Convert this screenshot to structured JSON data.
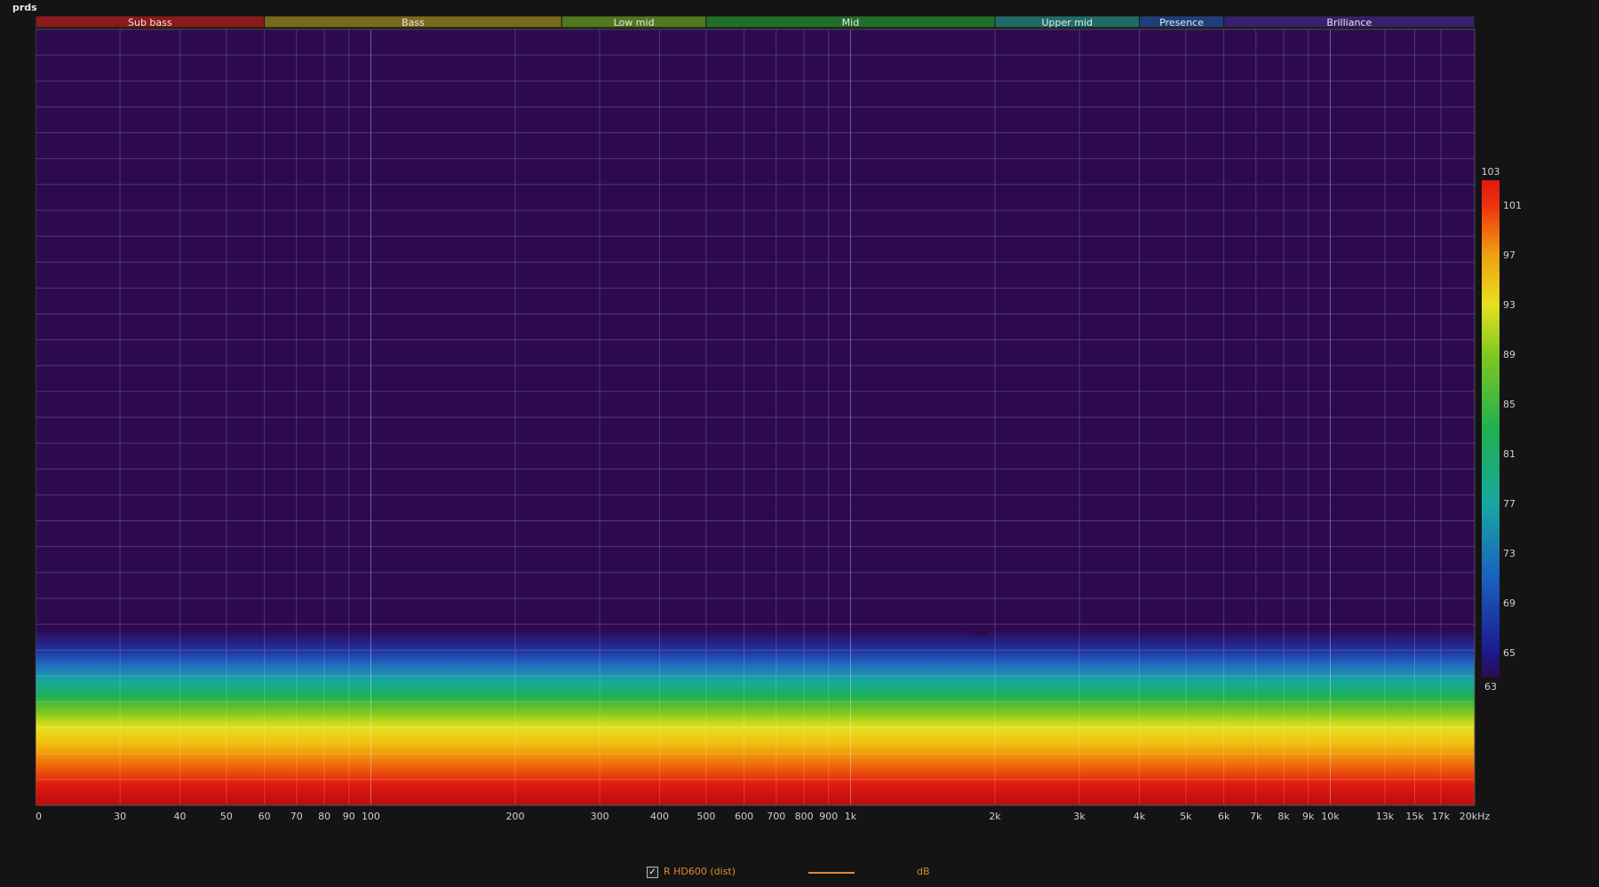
{
  "chart_data": {
    "type": "heatmap",
    "title": "",
    "ylabel_unit": "prds",
    "xlabel_unit": "Hz",
    "x_scale": "log",
    "xlim": [
      20,
      20000
    ],
    "ylim": [
      0,
      30
    ],
    "x_ticks": [
      {
        "value": 20,
        "label": "20"
      },
      {
        "value": 30,
        "label": "30"
      },
      {
        "value": 40,
        "label": "40"
      },
      {
        "value": 50,
        "label": "50"
      },
      {
        "value": 60,
        "label": "60"
      },
      {
        "value": 70,
        "label": "70"
      },
      {
        "value": 80,
        "label": "80"
      },
      {
        "value": 90,
        "label": "90"
      },
      {
        "value": 100,
        "label": "100"
      },
      {
        "value": 200,
        "label": "200"
      },
      {
        "value": 300,
        "label": "300"
      },
      {
        "value": 400,
        "label": "400"
      },
      {
        "value": 500,
        "label": "500"
      },
      {
        "value": 600,
        "label": "600"
      },
      {
        "value": 700,
        "label": "700"
      },
      {
        "value": 800,
        "label": "800"
      },
      {
        "value": 900,
        "label": "900"
      },
      {
        "value": 1000,
        "label": "1k"
      },
      {
        "value": 2000,
        "label": "2k"
      },
      {
        "value": 3000,
        "label": "3k"
      },
      {
        "value": 4000,
        "label": "4k"
      },
      {
        "value": 5000,
        "label": "5k"
      },
      {
        "value": 6000,
        "label": "6k"
      },
      {
        "value": 7000,
        "label": "7k"
      },
      {
        "value": 8000,
        "label": "8k"
      },
      {
        "value": 9000,
        "label": "9k"
      },
      {
        "value": 10000,
        "label": "10k"
      },
      {
        "value": 13000,
        "label": "13k"
      },
      {
        "value": 15000,
        "label": "15k"
      },
      {
        "value": 17000,
        "label": "17k"
      },
      {
        "value": 20000,
        "label": "20kHz"
      }
    ],
    "y_ticks": [
      1,
      2,
      3,
      4,
      5,
      6,
      7,
      8,
      9,
      10,
      11,
      12,
      13,
      14,
      15,
      16,
      17,
      18,
      19,
      20,
      21,
      22,
      23,
      24,
      25,
      26,
      27,
      28,
      29
    ],
    "bands": [
      {
        "name": "Sub bass",
        "from": 20,
        "to": 60,
        "color": "#8c1a1a"
      },
      {
        "name": "Bass",
        "from": 60,
        "to": 250,
        "color": "#7a6a1a"
      },
      {
        "name": "Low mid",
        "from": 250,
        "to": 500,
        "color": "#4f7a1f"
      },
      {
        "name": "Mid",
        "from": 500,
        "to": 2000,
        "color": "#236f2a"
      },
      {
        "name": "Upper mid",
        "from": 2000,
        "to": 4000,
        "color": "#1f6d66"
      },
      {
        "name": "Presence",
        "from": 4000,
        "to": 6000,
        "color": "#1f3f7a"
      },
      {
        "name": "Brilliance",
        "from": 6000,
        "to": 20000,
        "color": "#3a1f6a"
      }
    ],
    "colorbar": {
      "min": 63,
      "max": 103,
      "labels": [
        103,
        101,
        97,
        93,
        89,
        85,
        81,
        77,
        73,
        69,
        65,
        63
      ]
    },
    "floor_color": "#2d0a50",
    "ridges": [
      {
        "freq": 20,
        "height": 6.9
      },
      {
        "freq": 22,
        "height": 7.2
      },
      {
        "freq": 24,
        "height": 6.8
      },
      {
        "freq": 26,
        "height": 7.2
      },
      {
        "freq": 28,
        "height": 6.9
      },
      {
        "freq": 30,
        "height": 7.2
      },
      {
        "freq": 33,
        "height": 7.0
      },
      {
        "freq": 35.5,
        "height": 13.8
      },
      {
        "freq": 38,
        "height": 7.5
      },
      {
        "freq": 42,
        "height": 6.9
      },
      {
        "freq": 46,
        "height": 6.8
      },
      {
        "freq": 49,
        "height": 7.3
      },
      {
        "freq": 53,
        "height": 7.0
      },
      {
        "freq": 56,
        "height": 6.6
      },
      {
        "freq": 60,
        "height": 8.0
      },
      {
        "freq": 64,
        "height": 6.6
      },
      {
        "freq": 68,
        "height": 7.6
      },
      {
        "freq": 72,
        "height": 7.2
      },
      {
        "freq": 76,
        "height": 6.8
      },
      {
        "freq": 80,
        "height": 8.6
      },
      {
        "freq": 86,
        "height": 9.5
      },
      {
        "freq": 94,
        "height": 11.5
      },
      {
        "freq": 100,
        "height": 8.8
      },
      {
        "freq": 110,
        "height": 7.0
      },
      {
        "freq": 130,
        "height": 7.0
      },
      {
        "freq": 160,
        "height": 7.0
      },
      {
        "freq": 200,
        "height": 6.9
      },
      {
        "freq": 250,
        "height": 6.9
      },
      {
        "freq": 300,
        "height": 6.8
      },
      {
        "freq": 350,
        "height": 6.8
      },
      {
        "freq": 400,
        "height": 6.8
      },
      {
        "freq": 450,
        "height": 6.8
      },
      {
        "freq": 500,
        "height": 6.9
      },
      {
        "freq": 560,
        "height": 6.9
      },
      {
        "freq": 600,
        "height": 6.9
      },
      {
        "freq": 650,
        "height": 7.1
      },
      {
        "freq": 700,
        "height": 6.8
      },
      {
        "freq": 760,
        "height": 7.0
      },
      {
        "freq": 820,
        "height": 6.8
      },
      {
        "freq": 880,
        "height": 9.0
      },
      {
        "freq": 930,
        "height": 11.0
      },
      {
        "freq": 980,
        "height": 8.0
      },
      {
        "freq": 1100,
        "height": 6.9
      },
      {
        "freq": 1300,
        "height": 6.9
      },
      {
        "freq": 1600,
        "height": 6.9
      },
      {
        "freq": 1900,
        "height": 6.5
      },
      {
        "freq": 2000,
        "height": 7.0
      },
      {
        "freq": 2200,
        "height": 8.0
      },
      {
        "freq": 2500,
        "height": 6.8
      },
      {
        "freq": 2800,
        "height": 8.0
      },
      {
        "freq": 3200,
        "height": 7.5
      },
      {
        "freq": 3600,
        "height": 7.0
      },
      {
        "freq": 4000,
        "height": 7.5
      },
      {
        "freq": 4500,
        "height": 9.5
      },
      {
        "freq": 5000,
        "height": 9.0
      },
      {
        "freq": 5500,
        "height": 12.0
      },
      {
        "freq": 6000,
        "height": 14.8
      },
      {
        "freq": 6500,
        "height": 12.5
      },
      {
        "freq": 7000,
        "height": 10.0
      },
      {
        "freq": 7500,
        "height": 9.0
      },
      {
        "freq": 8000,
        "height": 11.0
      },
      {
        "freq": 8500,
        "height": 15.0
      },
      {
        "freq": 9000,
        "height": 20.0
      },
      {
        "freq": 9500,
        "height": 26.0
      },
      {
        "freq": 10000,
        "height": 30.0
      },
      {
        "freq": 20000,
        "height": 30.0
      }
    ]
  },
  "legend": {
    "checkbox_mark": "✓",
    "series_label": "R HD600 (dist)",
    "unit_label": "dB",
    "series_color": "#e08a2e"
  }
}
